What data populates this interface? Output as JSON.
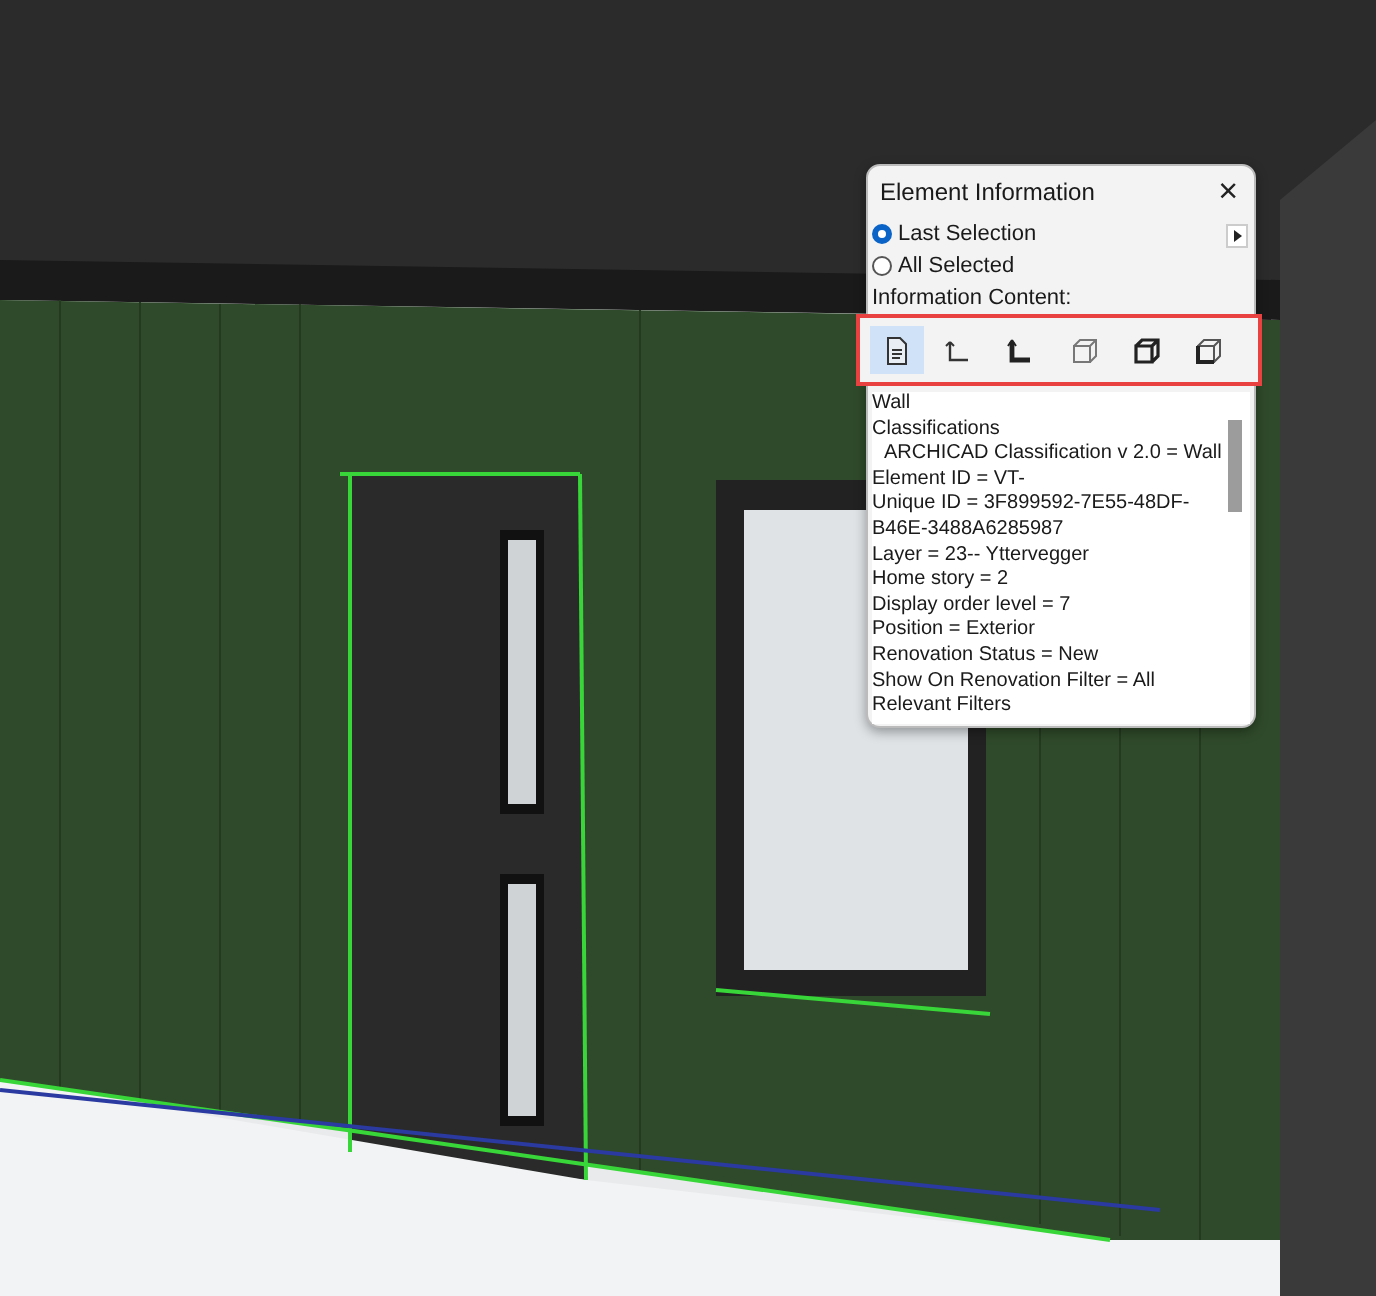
{
  "dialog": {
    "title": "Element Information",
    "close": "×",
    "scope": [
      {
        "label": "Last Selection",
        "selected": true
      },
      {
        "label": "All Selected",
        "selected": false
      }
    ],
    "content_label": "Information Content:",
    "content_buttons": [
      {
        "kind": "document",
        "selected": true
      },
      {
        "kind": "corner",
        "selected": false
      },
      {
        "kind": "corner-bold",
        "selected": false
      },
      {
        "kind": "box",
        "selected": false
      },
      {
        "kind": "box-bold",
        "selected": false
      },
      {
        "kind": "box-corner",
        "selected": false
      }
    ],
    "info": [
      {
        "text": "Wall"
      },
      {
        "text": "Classifications",
        "children": [
          {
            "text": "ARCHICAD Classification v 2.0 = Wall"
          }
        ]
      },
      {
        "text": "Element ID = VT-"
      },
      {
        "text": "Unique ID = 3F899592-7E55-48DF-B46E-3488A6285987"
      },
      {
        "text": "Layer = 23-- Yttervegger"
      },
      {
        "text": "Home story = 2"
      },
      {
        "text": "Display order level = 7"
      },
      {
        "text": "Position = Exterior"
      },
      {
        "text": "Renovation Status = New"
      },
      {
        "text": "Show On Renovation Filter = All"
      },
      {
        "text": "Relevant Filters"
      }
    ]
  }
}
